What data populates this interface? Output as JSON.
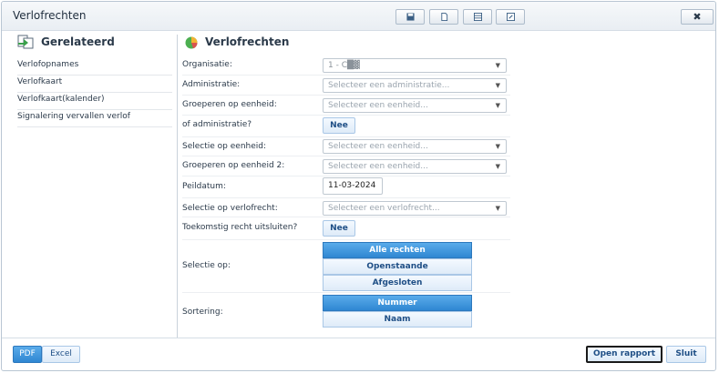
{
  "window": {
    "title": "Verlofrechten",
    "close_symbol": "✖"
  },
  "sidebar": {
    "title": "Gerelateerd",
    "items": [
      {
        "label": "Verlofopnames"
      },
      {
        "label": "Verlofkaart"
      },
      {
        "label": "Verlofkaart(kalender)"
      },
      {
        "label": "Signalering vervallen verlof"
      }
    ]
  },
  "main": {
    "title": "Verlofrechten",
    "fields": {
      "organisatie": {
        "label": "Organisatie:",
        "value": "1 - C█▓"
      },
      "administratie": {
        "label": "Administratie:",
        "placeholder": "Selecteer een administratie..."
      },
      "groeperen": {
        "label": "Groeperen op eenheid:",
        "placeholder": "Selecteer een eenheid..."
      },
      "of_administratie": {
        "label": "of administratie?",
        "value": "Nee"
      },
      "selectie_eenheid": {
        "label": "Selectie op eenheid:",
        "placeholder": "Selecteer een eenheid..."
      },
      "groeperen2": {
        "label": "Groeperen op eenheid 2:",
        "placeholder": "Selecteer een eenheid..."
      },
      "peildatum": {
        "label": "Peildatum:",
        "value": "11-03-2024"
      },
      "selectie_verlofrecht": {
        "label": "Selectie op verlofrecht:",
        "placeholder": "Selecteer een verlofrecht..."
      },
      "toekomstig": {
        "label": "Toekomstig recht uitsluiten?",
        "value": "Nee"
      },
      "selectie_op": {
        "label": "Selectie op:",
        "options": [
          "Alle rechten",
          "Openstaande",
          "Afgesloten"
        ],
        "selected": "Alle rechten"
      },
      "sortering": {
        "label": "Sortering:",
        "options": [
          "Nummer",
          "Naam"
        ],
        "selected": "Nummer"
      }
    }
  },
  "footer": {
    "pdf_label": "PDF",
    "excel_label": "Excel",
    "open_label": "Open rapport",
    "sluit_label": "Sluit"
  },
  "colors": {
    "accent": "#2f87d2",
    "accent_light": "#deebf8",
    "border": "#bfc8d1"
  }
}
